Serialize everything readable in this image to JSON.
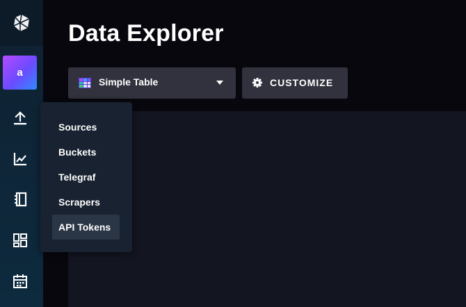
{
  "page": {
    "title": "Data Explorer"
  },
  "sidebar": {
    "logo_icon": "influx-cube-icon",
    "avatar_letter": "a",
    "nav_icons": [
      "upload-icon",
      "graph-icon",
      "notebook-icon",
      "dashboard-icon",
      "calendar-icon"
    ]
  },
  "flyout": {
    "items": [
      {
        "label": "Sources",
        "active": false
      },
      {
        "label": "Buckets",
        "active": false
      },
      {
        "label": "Telegraf",
        "active": false
      },
      {
        "label": "Scrapers",
        "active": false
      },
      {
        "label": "API Tokens",
        "active": true
      }
    ]
  },
  "toolbar": {
    "vis_type_label": "Simple Table",
    "vis_icon": "simple-table-icon",
    "customize_label": "CUSTOMIZE",
    "customize_icon": "gear-icon"
  },
  "colors": {
    "background": "#07070d",
    "sidebar": "#0f2131",
    "button": "#32323e",
    "flyout": "#182231",
    "viz_area": "#131521"
  }
}
